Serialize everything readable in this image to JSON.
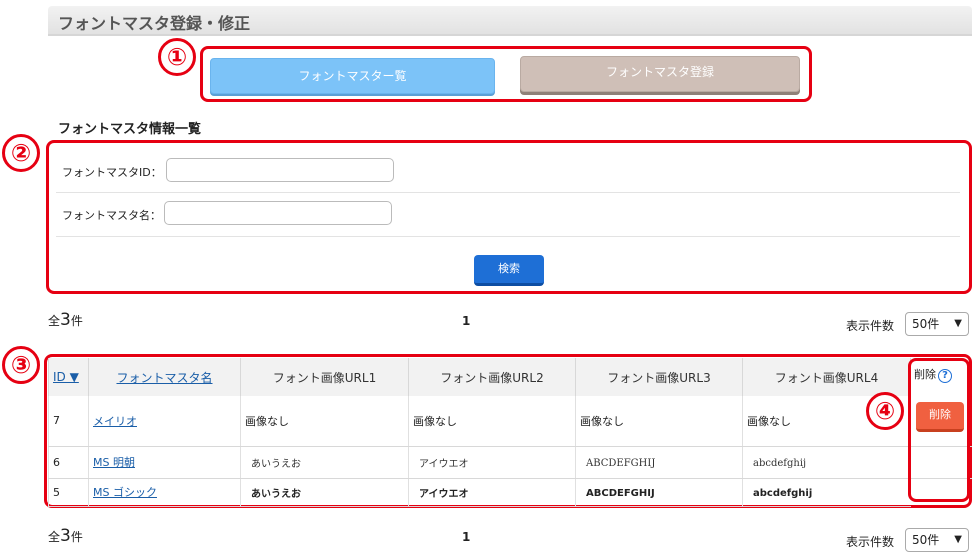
{
  "header": {
    "title": "フォントマスタ登録・修正"
  },
  "tabs": {
    "list": "フォントマスター覧",
    "register": "フォントマスタ登録"
  },
  "annotations": [
    "①",
    "②",
    "③",
    "④"
  ],
  "search": {
    "section_title": "フォントマスタ情報一覧",
    "id_label": "フォントマスタID：",
    "id_value": "",
    "name_label": "フォントマスタ名：",
    "name_value": "",
    "button": "検索"
  },
  "summary": {
    "prefix": "全",
    "count": "3",
    "suffix": "件",
    "page": "1",
    "perpage_label": "表示件数",
    "perpage_value": "50件"
  },
  "table": {
    "headers": [
      "ID ▼",
      "フォントマスタ名",
      "フォント画像URL1",
      "フォント画像URL2",
      "フォント画像URL3",
      "フォント画像URL4"
    ],
    "rows": [
      {
        "id": "7",
        "name": "メイリオ",
        "url1": "画像なし",
        "url2": "画像なし",
        "url3": "画像なし",
        "url4": "画像なし"
      },
      {
        "id": "6",
        "name": "MS 明朝",
        "url1": "あいうえお",
        "url2": "アイウエオ",
        "url3": "ABCDEFGHIJ",
        "url4": "abcdefghij"
      },
      {
        "id": "5",
        "name": "MS ゴシック",
        "url1": "あいうえお",
        "url2": "アイウエオ",
        "url3": "ABCDEFGHIJ",
        "url4": "abcdefghij"
      }
    ],
    "delete_header": "削除",
    "help_glyph": "?",
    "delete_button": "削除"
  },
  "colors": {
    "annotation": "#e60012",
    "primary": "#1e6fd6",
    "danger": "#f06040",
    "tab_active": "#7cc3f8",
    "tab_inactive": "#cfbfb7"
  }
}
